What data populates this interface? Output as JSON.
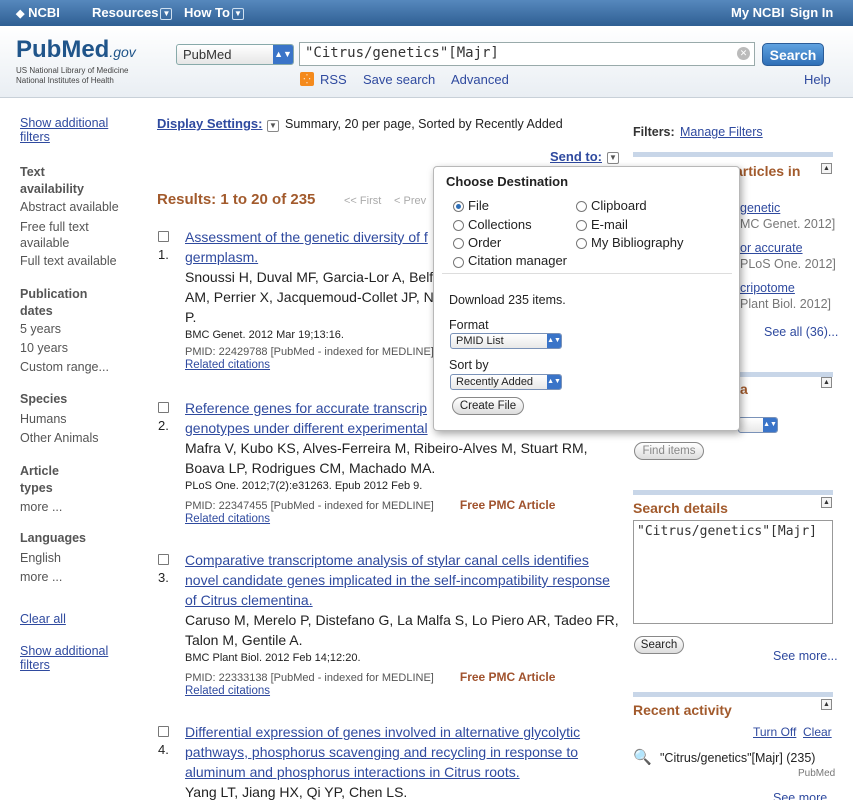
{
  "topbar": {
    "ncbi": "NCBI",
    "resources": "Resources",
    "howto": "How To",
    "myncbi": "My NCBI",
    "signin": "Sign In"
  },
  "header": {
    "logo": "PubMed",
    "logo_gov": ".gov",
    "org1": "US National Library of Medicine",
    "org2": "National Institutes of Health",
    "db": "PubMed",
    "query": "\"Citrus/genetics\"[Majr]",
    "search": "Search",
    "rss": "RSS",
    "save_search": "Save search",
    "advanced": "Advanced",
    "help": "Help"
  },
  "sidebar": {
    "show_filters_top": "Show additional filters",
    "groups": [
      {
        "head": "Text availability",
        "items": [
          "Abstract available",
          "Free full text available",
          "Full text available"
        ]
      },
      {
        "head": "Publication dates",
        "items": [
          "5 years",
          "10 years",
          "Custom range..."
        ]
      },
      {
        "head": "Species",
        "items": [
          "Humans",
          "Other Animals"
        ]
      },
      {
        "head": "Article types",
        "items": [
          "more ..."
        ]
      },
      {
        "head": "Languages",
        "items": [
          "English",
          "more ..."
        ]
      }
    ],
    "clear_all": "Clear all",
    "show_filters_bottom": "Show additional filters"
  },
  "main": {
    "display_settings": "Display Settings:",
    "display_summary": "Summary, 20 per page, Sorted by Recently Added",
    "send_to": "Send to:",
    "results": "Results: 1 to 20 of 235",
    "first": "<< First",
    "prev": "< Prev",
    "items": [
      {
        "num": "1.",
        "title": [
          "Assessment of the genetic diversity of f",
          "germplasm."
        ],
        "authors": [
          "Snoussi H, Duval MF, Garcia-Lor A, Belf",
          "AM, Perrier X, Jacquemoud-Collet JP, N",
          "P."
        ],
        "journal": "BMC Genet. 2012 Mar 19;13:16.",
        "pmid": "PMID: 22429788 [PubMed - indexed for MEDLINE]",
        "free": "",
        "related": "Related citations"
      },
      {
        "num": "2.",
        "title": [
          "Reference genes for accurate transcrip",
          "genotypes under different experimental"
        ],
        "authors": [
          "Mafra V, Kubo KS, Alves-Ferreira M, Ribeiro-Alves M, Stuart RM,",
          "Boava LP, Rodrigues CM, Machado MA."
        ],
        "journal": "PLoS One. 2012;7(2):e31263. Epub 2012 Feb 9.",
        "pmid": "PMID: 22347455 [PubMed - indexed for MEDLINE]",
        "free": "Free PMC Article",
        "related": "Related citations"
      },
      {
        "num": "3.",
        "title": [
          "Comparative transcriptome analysis of stylar canal cells identifies",
          "novel candidate genes implicated in the self-incompatibility response",
          "of Citrus clementina."
        ],
        "authors": [
          "Caruso M, Merelo P, Distefano G, La Malfa S, Lo Piero AR, Tadeo FR,",
          "Talon M, Gentile A."
        ],
        "journal": "BMC Plant Biol. 2012 Feb 14;12:20.",
        "pmid": "PMID: 22333138 [PubMed - indexed for MEDLINE]",
        "free": "Free PMC Article",
        "related": "Related citations"
      },
      {
        "num": "4.",
        "title": [
          "Differential expression of genes involved in alternative glycolytic",
          "pathways, phosphorus scavenging and recycling in response to",
          "aluminum and phosphorus interactions in Citrus roots."
        ],
        "authors": [
          "Yang LT, Jiang HX, Qi YP, Chen LS."
        ],
        "journal": "",
        "pmid": "",
        "free": "",
        "related": ""
      }
    ]
  },
  "right": {
    "filters": "Filters:",
    "manage_filters": "Manage Filters",
    "box1_title_partial": "articles in",
    "box1_items": [
      [
        "genetic",
        "MC Genet. 2012]"
      ],
      [
        "or accurate",
        "PLoS One. 2012]"
      ],
      [
        "cripotome",
        "Plant Biol. 2012]"
      ]
    ],
    "see_all": "See all (36)...",
    "box2_title_partial": "a",
    "find_items": "Find items",
    "search_details": "Search details",
    "details_query": "\"Citrus/genetics\"[Majr]",
    "details_search": "Search",
    "see_more": "See more...",
    "recent_activity": "Recent activity",
    "turn_off": "Turn Off",
    "clear": "Clear",
    "recent_query": "\"Citrus/genetics\"[Majr] (235)",
    "recent_db": "PubMed",
    "see_more2": "See more..."
  },
  "popup": {
    "title": "Choose Destination",
    "options_left": [
      "File",
      "Collections",
      "Order",
      "Citation manager"
    ],
    "options_right": [
      "Clipboard",
      "E-mail",
      "My Bibliography"
    ],
    "download": "Download 235 items.",
    "format_label": "Format",
    "format_value": "PMID List",
    "sort_label": "Sort by",
    "sort_value": "Recently Added",
    "create": "Create File"
  }
}
